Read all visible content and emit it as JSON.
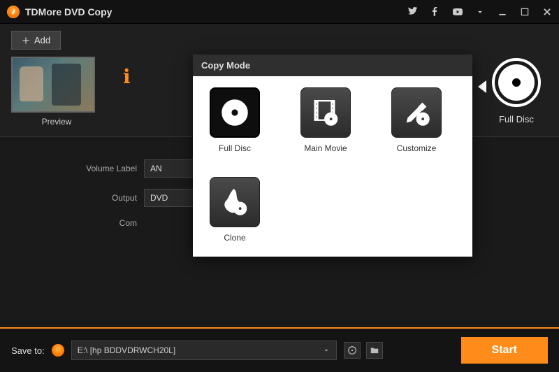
{
  "app": {
    "title": "TDMore DVD Copy"
  },
  "toolbar": {
    "add_label": "Add"
  },
  "preview": {
    "label": "Preview"
  },
  "mode_current": {
    "label": "Full Disc"
  },
  "form": {
    "volume_label": "Volume Label",
    "volume_value": "AN",
    "output_label": "Output",
    "output_value": "DVD",
    "common_label": "Com"
  },
  "popup": {
    "title": "Copy Mode",
    "items": [
      {
        "label": "Full Disc"
      },
      {
        "label": "Main Movie"
      },
      {
        "label": "Customize"
      },
      {
        "label": "Clone"
      }
    ]
  },
  "bottom": {
    "save_label": "Save to:",
    "save_value": "E:\\ [hp BDDVDRWCH20L]",
    "start_label": "Start"
  }
}
